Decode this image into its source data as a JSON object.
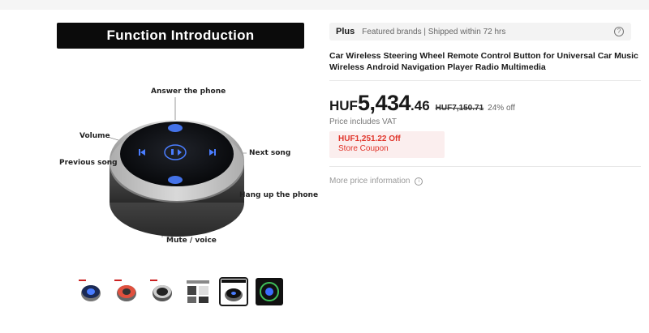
{
  "gallery": {
    "banner_title": "Function  Introduction",
    "callouts": {
      "answer": "Answer the phone",
      "volume": "Volume",
      "previous": "Previous song",
      "next": "Next song",
      "hangup": "Hang up the phone",
      "mute": "Mute / voice"
    },
    "thumbnails": [
      {
        "name": "thumb-1",
        "selected": false
      },
      {
        "name": "thumb-2",
        "selected": false
      },
      {
        "name": "thumb-3",
        "selected": false
      },
      {
        "name": "thumb-4",
        "selected": false
      },
      {
        "name": "thumb-5",
        "selected": true
      },
      {
        "name": "thumb-6",
        "selected": false
      }
    ]
  },
  "plus": {
    "label": "Plus",
    "description": "Featured brands | Shipped within 72 hrs",
    "help_icon": "?"
  },
  "product": {
    "title": "Car Wireless Steering Wheel Remote Control Button for Universal Car Music Wireless Android Navigation Player Radio Multimedia"
  },
  "price": {
    "currency": "HUF",
    "integer": "5,434",
    "decimal": ".46",
    "original": "HUF7,150.71",
    "discount": "24% off",
    "vat_note": "Price includes VAT"
  },
  "coupon": {
    "amount": "HUF1,251.22 Off",
    "label": "Store Coupon"
  },
  "more_info": {
    "label": "More price information",
    "icon": "i"
  },
  "colors": {
    "accent_red": "#e0342a",
    "coupon_bg": "#fbeeee",
    "device_glow": "#4a7dff"
  }
}
